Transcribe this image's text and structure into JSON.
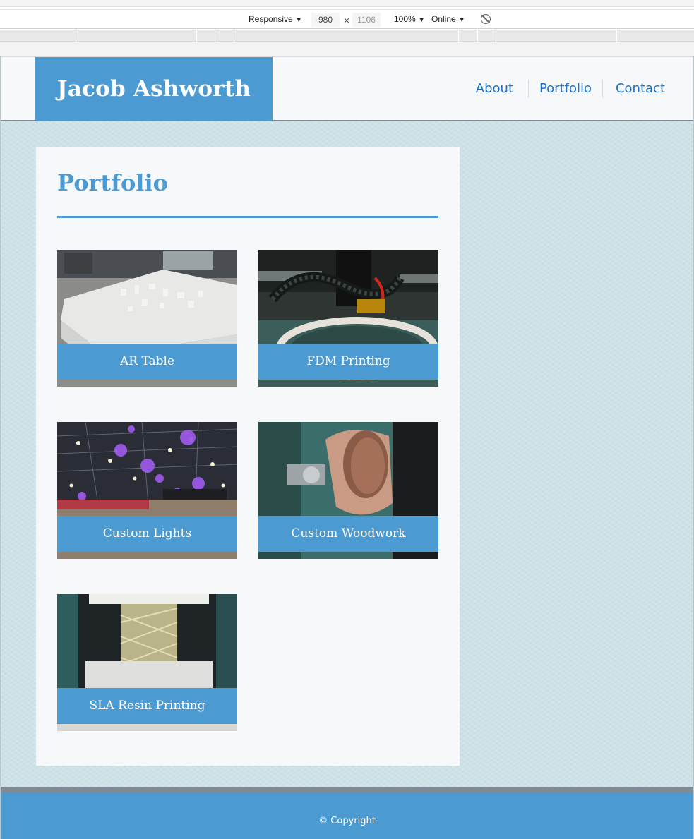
{
  "devtools": {
    "device": "Responsive",
    "width": "980",
    "times": "×",
    "height": "1106",
    "zoom": "100%",
    "network": "Online",
    "rotate_icon": "rotate-icon"
  },
  "site": {
    "brand": "Jacob Ashworth",
    "nav": [
      "About",
      "Portfolio",
      "Contact"
    ],
    "accent_color": "#4b9bd2",
    "link_color": "#1a73c8"
  },
  "portfolio": {
    "title": "Portfolio",
    "items": [
      {
        "label": "AR Table"
      },
      {
        "label": "FDM Printing"
      },
      {
        "label": "Custom Lights"
      },
      {
        "label": "Custom Woodwork"
      },
      {
        "label": "SLA Resin Printing"
      }
    ]
  },
  "footer": {
    "copyright": "© Copyright"
  }
}
